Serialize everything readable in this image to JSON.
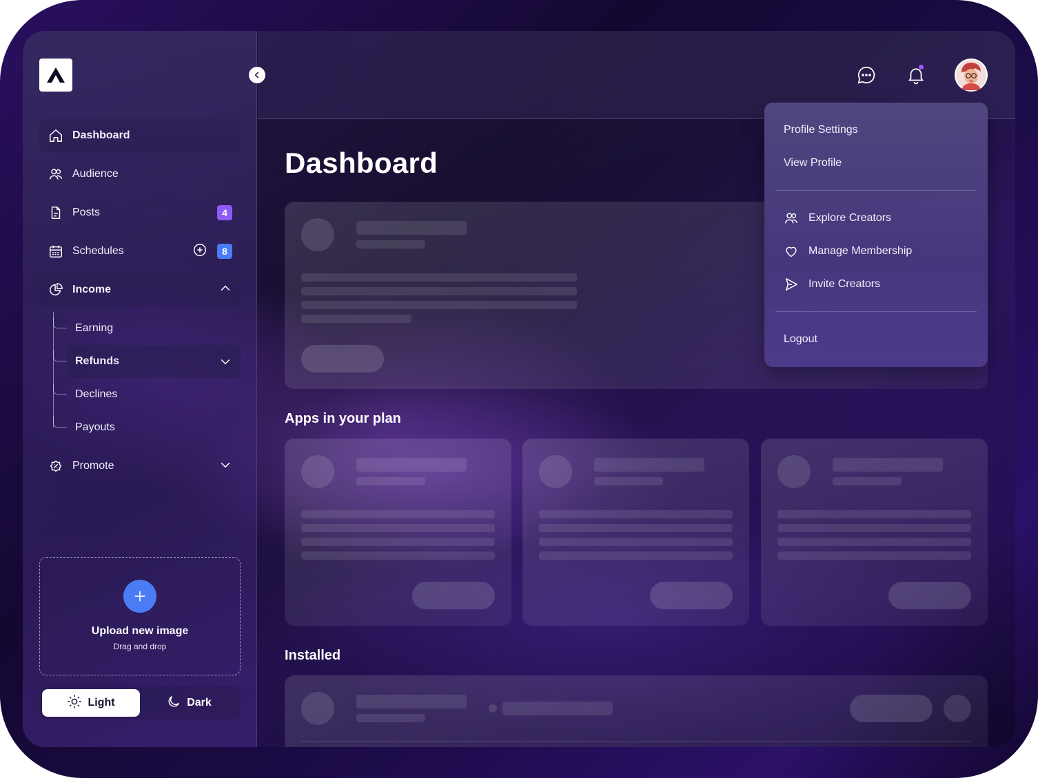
{
  "sidebar": {
    "nav": [
      {
        "label": "Dashboard",
        "icon": "home-icon"
      },
      {
        "label": "Audience",
        "icon": "users-icon"
      },
      {
        "label": "Posts",
        "icon": "document-icon",
        "badge": "4"
      },
      {
        "label": "Schedules",
        "icon": "calendar-icon",
        "badge": "8"
      },
      {
        "label": "Income",
        "icon": "pie-chart-icon"
      },
      {
        "label": "Promote",
        "icon": "discount-icon"
      }
    ],
    "income_sub": [
      "Earning",
      "Refunds",
      "Declines",
      "Payouts"
    ],
    "upload": {
      "title": "Upload new image",
      "subtitle": "Drag and drop"
    },
    "theme": {
      "light": "Light",
      "dark": "Dark"
    }
  },
  "main": {
    "title": "Dashboard",
    "apps_section": "Apps in your plan",
    "installed_section": "Installed"
  },
  "profile_menu": {
    "items": [
      "Profile Settings",
      "View Profile",
      "Explore Creators",
      "Manage Membership",
      "Invite Creators",
      "Logout"
    ]
  },
  "colors": {
    "accent_blue": "#4a7cf5",
    "badge_purple": "#8b5cf6",
    "notification_dot": "#a855f7"
  }
}
